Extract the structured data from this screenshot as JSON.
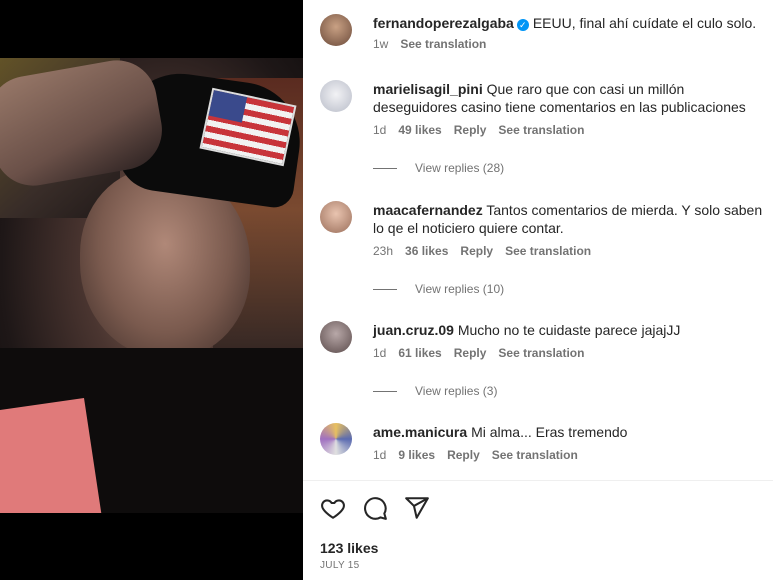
{
  "post": {
    "author": "fernandoperezalgaba",
    "caption": "EEUU, final ahí cuídate el culo solo.",
    "age": "1w",
    "see_translation": "See translation"
  },
  "comments": [
    {
      "user": "marielisagil_pini",
      "text": "Que raro que con casi un millón deseguidores casino tiene comentarios en las publicaciones",
      "age": "1d",
      "likes": "49 likes",
      "reply": "Reply",
      "see_translation": "See translation",
      "view_replies": "View replies (28)",
      "avatar_color": "#d9dde8"
    },
    {
      "user": "maacafernandez",
      "text": "Tantos comentarios de mierda. Y solo saben lo qe el noticiero quiere contar.",
      "age": "23h",
      "likes": "36 likes",
      "reply": "Reply",
      "see_translation": "See translation",
      "view_replies": "View replies (10)",
      "avatar_color": "#c89a86"
    },
    {
      "user": "juan.cruz.09",
      "text": "Mucho no te cuidaste parece jajajJJ",
      "age": "1d",
      "likes": "61 likes",
      "reply": "Reply",
      "see_translation": "See translation",
      "view_replies": "View replies (3)",
      "avatar_color": "#8d8080"
    },
    {
      "user": "ame.manicura",
      "text": "Mi alma... Eras tremendo",
      "age": "1d",
      "likes": "9 likes",
      "reply": "Reply",
      "see_translation": "See translation",
      "view_replies": "",
      "avatar_color": "#7a6aa0"
    }
  ],
  "actions": {
    "like": "heart-icon",
    "comment": "comment-icon",
    "share": "share-icon"
  },
  "likes_count": "123 likes",
  "date": "JULY 15"
}
